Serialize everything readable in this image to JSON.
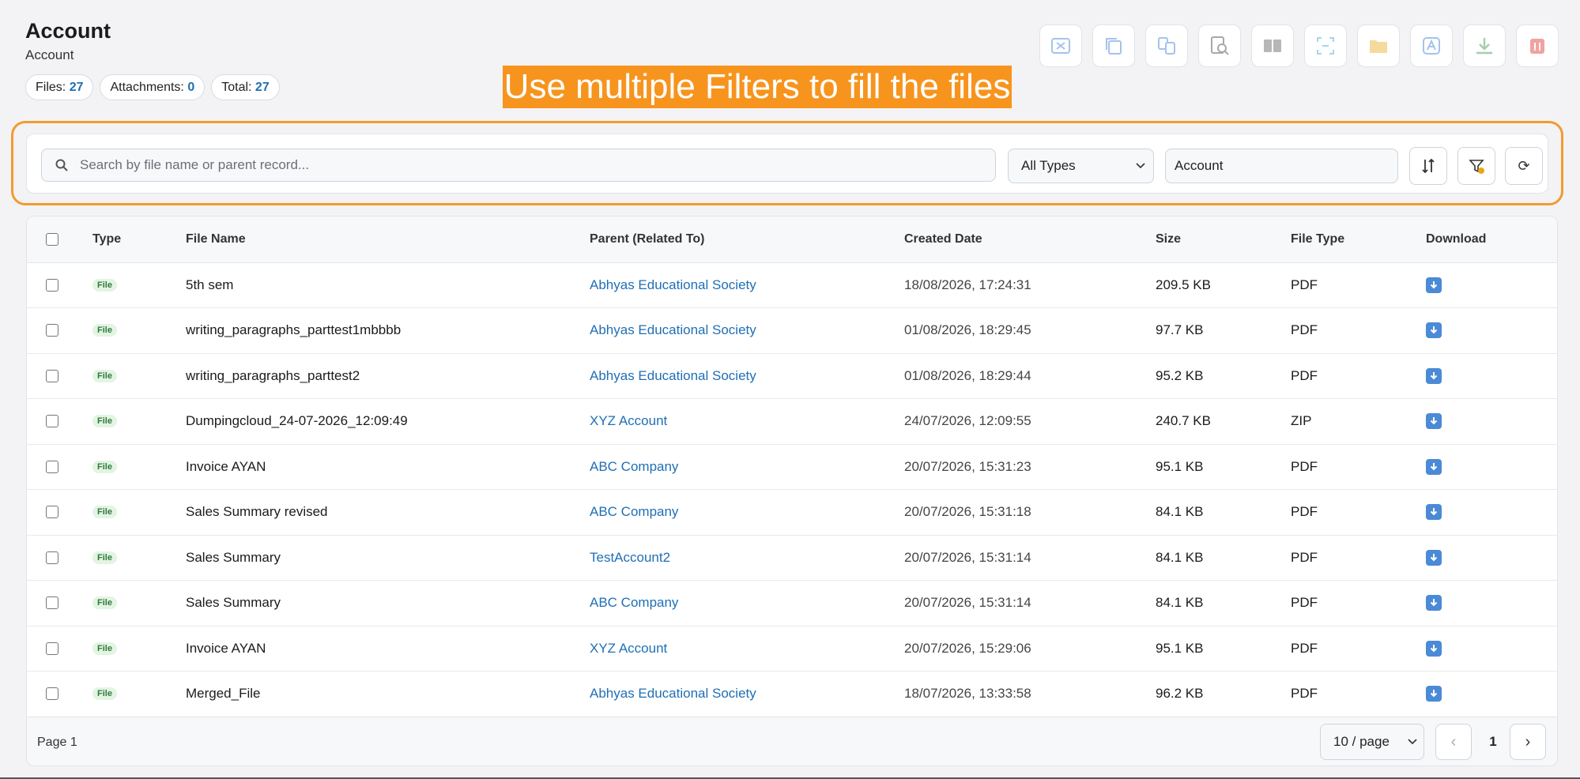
{
  "header": {
    "title": "Account",
    "subtitle": "Account",
    "stats": [
      {
        "label": "Files:",
        "value": "27"
      },
      {
        "label": "Attachments:",
        "value": "0"
      },
      {
        "label": "Total:",
        "value": "27"
      }
    ]
  },
  "toolbar": {
    "buttons": [
      {
        "icon": "merge-pdf-icon"
      },
      {
        "icon": "copy-icon"
      },
      {
        "icon": "convert-icon"
      },
      {
        "icon": "preview-icon"
      },
      {
        "icon": "compare-icon"
      },
      {
        "icon": "split-icon"
      },
      {
        "icon": "folder-icon"
      },
      {
        "icon": "translate-icon"
      },
      {
        "icon": "download-icon"
      },
      {
        "icon": "delete-icon"
      }
    ]
  },
  "banner": {
    "text": "Use multiple Filters to fill the files"
  },
  "filters": {
    "search_placeholder": "Search by file name or parent record...",
    "search_value": "",
    "type_selected": "All Types",
    "object_value": "Account",
    "sort_icon": "sort-icon",
    "clear_filter_icon": "clear-filter-icon",
    "refresh_glyph": "⟳"
  },
  "table": {
    "headers": {
      "type": "Type",
      "name": "File Name",
      "parent": "Parent (Related To)",
      "date": "Created Date",
      "size": "Size",
      "file_type": "File Type",
      "download": "Download"
    },
    "rows": [
      {
        "badge": "File",
        "name": "5th sem",
        "parent": "Abhyas Educational Society",
        "date": "18/08/2026, 17:24:31",
        "size": "209.5 KB",
        "file_type": "PDF"
      },
      {
        "badge": "File",
        "name": "writing_paragraphs_parttest1mbbbb",
        "parent": "Abhyas Educational Society",
        "date": "01/08/2026, 18:29:45",
        "size": "97.7 KB",
        "file_type": "PDF"
      },
      {
        "badge": "File",
        "name": "writing_paragraphs_parttest2",
        "parent": "Abhyas Educational Society",
        "date": "01/08/2026, 18:29:44",
        "size": "95.2 KB",
        "file_type": "PDF"
      },
      {
        "badge": "File",
        "name": "Dumpingcloud_24-07-2026_12:09:49",
        "parent": "XYZ Account",
        "date": "24/07/2026, 12:09:55",
        "size": "240.7 KB",
        "file_type": "ZIP"
      },
      {
        "badge": "File",
        "name": "Invoice AYAN",
        "parent": "ABC Company",
        "date": "20/07/2026, 15:31:23",
        "size": "95.1 KB",
        "file_type": "PDF"
      },
      {
        "badge": "File",
        "name": "Sales Summary revised",
        "parent": "ABC Company",
        "date": "20/07/2026, 15:31:18",
        "size": "84.1 KB",
        "file_type": "PDF"
      },
      {
        "badge": "File",
        "name": "Sales Summary",
        "parent": "TestAccount2",
        "date": "20/07/2026, 15:31:14",
        "size": "84.1 KB",
        "file_type": "PDF"
      },
      {
        "badge": "File",
        "name": "Sales Summary",
        "parent": "ABC Company",
        "date": "20/07/2026, 15:31:14",
        "size": "84.1 KB",
        "file_type": "PDF"
      },
      {
        "badge": "File",
        "name": "Invoice AYAN",
        "parent": "XYZ Account",
        "date": "20/07/2026, 15:29:06",
        "size": "95.1 KB",
        "file_type": "PDF"
      },
      {
        "badge": "File",
        "name": "Merged_File",
        "parent": "Abhyas Educational Society",
        "date": "18/07/2026, 13:33:58",
        "size": "96.2 KB",
        "file_type": "PDF"
      }
    ]
  },
  "pagination": {
    "page_label": "Page 1",
    "per_page": "10 / page",
    "current": "1",
    "prev_glyph": "‹",
    "next_glyph": "›"
  },
  "colors": {
    "accent": "#1f6fb5",
    "banner": "#f7941d",
    "filter_border": "#f29b30",
    "badge_bg": "#e3f4e3",
    "badge_text": "#2f7a3b"
  }
}
